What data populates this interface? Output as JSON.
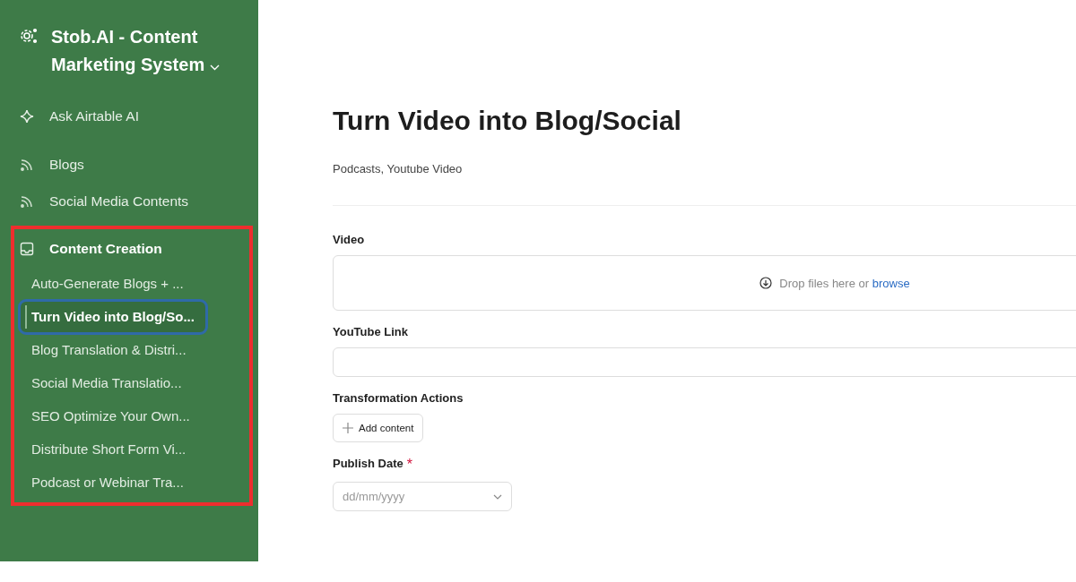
{
  "workspace": {
    "title": "Stob.AI - Content Marketing System"
  },
  "nav": [
    {
      "label": "Ask Airtable AI",
      "kind": "ai"
    },
    {
      "label": "Blogs",
      "kind": "feed"
    },
    {
      "label": "Social Media Contents",
      "kind": "feed"
    }
  ],
  "section": {
    "label": "Content Creation",
    "children": [
      {
        "label": "Auto-Generate Blogs + ...",
        "selected": false
      },
      {
        "label": "Turn Video into Blog/So...",
        "selected": true
      },
      {
        "label": "Blog Translation & Distri...",
        "selected": false
      },
      {
        "label": "Social Media Translatio...",
        "selected": false
      },
      {
        "label": "SEO Optimize Your Own...",
        "selected": false
      },
      {
        "label": "Distribute Short Form Vi...",
        "selected": false
      },
      {
        "label": "Podcast or Webinar Tra...",
        "selected": false
      }
    ]
  },
  "form": {
    "title": "Turn Video into Blog/Social",
    "subtitle": "Podcasts, Youtube Video",
    "fields": [
      {
        "kind": "dropzone",
        "label": "Video",
        "hint": "Drop files here or",
        "link": "browse"
      },
      {
        "kind": "text",
        "label": "YouTube Link"
      },
      {
        "kind": "links",
        "label": "Transformation Actions",
        "button": "Add content"
      },
      {
        "kind": "date",
        "label": "Publish Date",
        "required_mark": "*",
        "placeholder": "dd/mm/yyyy"
      }
    ]
  }
}
